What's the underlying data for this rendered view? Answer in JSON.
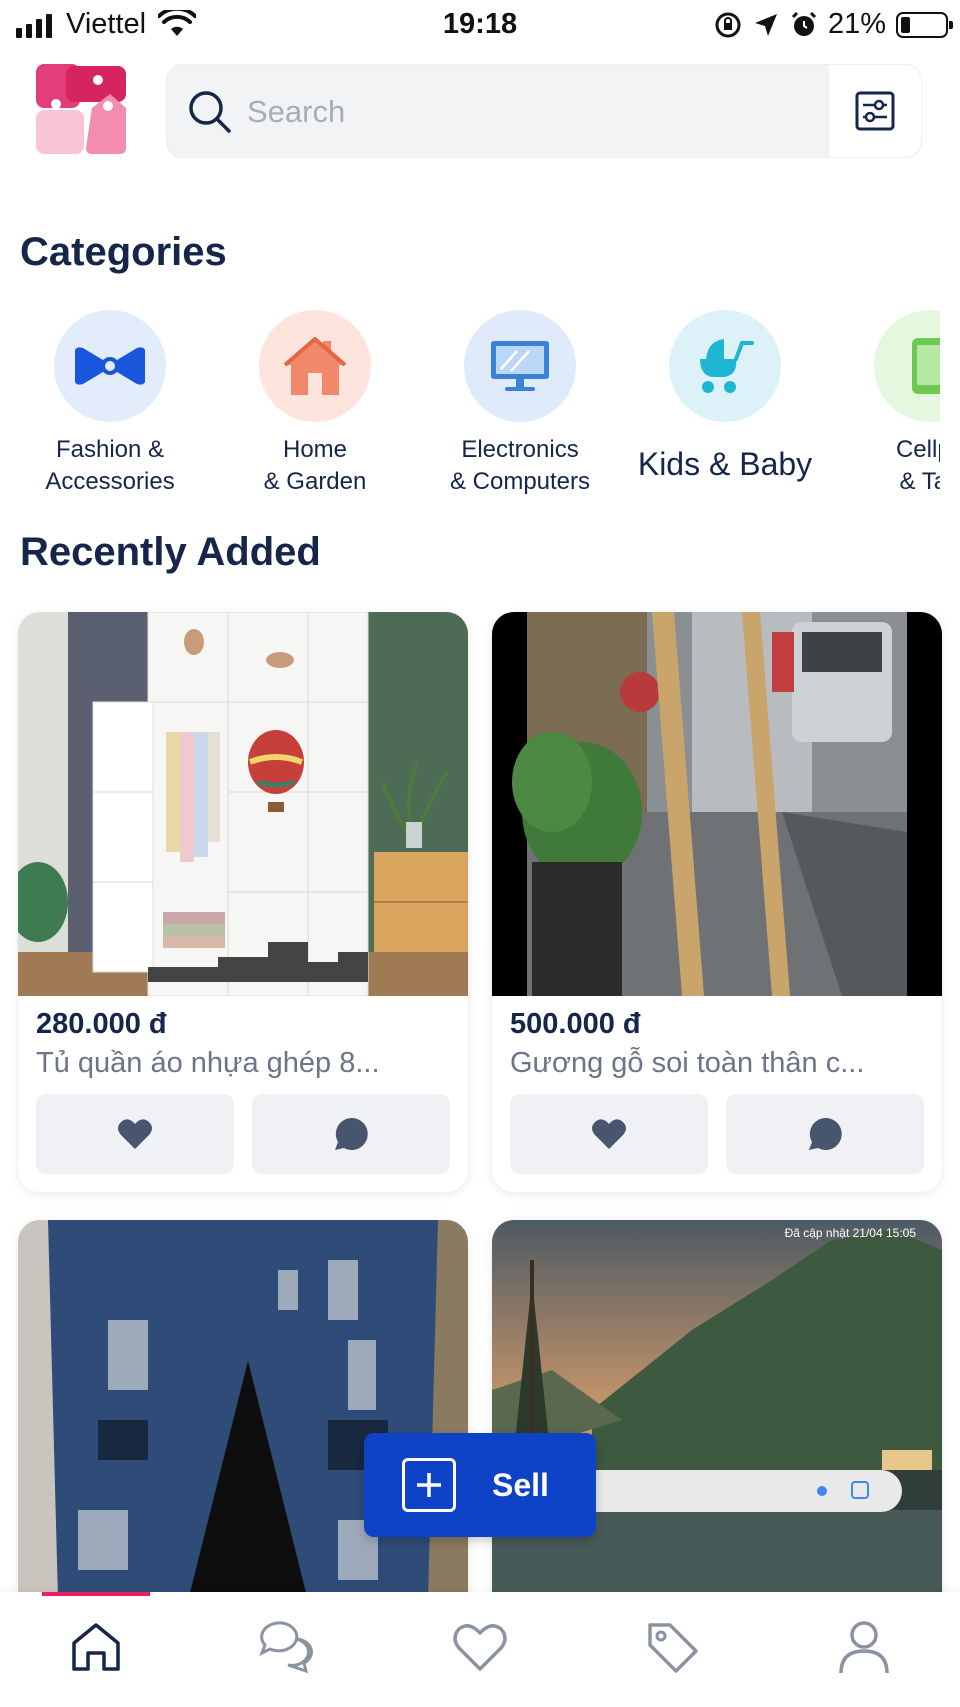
{
  "status_bar": {
    "carrier": "Viettel",
    "time": "19:18",
    "battery_percent": "21%",
    "battery_level": 0.21,
    "icons": [
      "signal-icon",
      "wifi-icon",
      "orientation-lock-icon",
      "location-icon",
      "alarm-icon",
      "battery-icon"
    ]
  },
  "header": {
    "logo": "app-logo",
    "search": {
      "placeholder": "Search",
      "value": ""
    },
    "filter_icon": "sliders-icon"
  },
  "categories": {
    "title": "Categories",
    "items": [
      {
        "label": "Fashion &\nAccessories",
        "icon": "bowtie-icon",
        "bg": "#e3ecfb",
        "color": "#1a56db"
      },
      {
        "label": "Home\n& Garden",
        "icon": "house-icon",
        "bg": "#fde4dc",
        "color": "#f2886b"
      },
      {
        "label": "Electronics\n& Computers",
        "icon": "monitor-icon",
        "bg": "#dfeafa",
        "color": "#3b82d6"
      },
      {
        "label": "Kids & Baby",
        "icon": "stroller-icon",
        "bg": "#dcf2f8",
        "color": "#1fb6d6"
      },
      {
        "label": "Cellph\n& Tab",
        "icon": "phone-icon",
        "bg": "#e6f7df",
        "color": "#6cc951"
      }
    ]
  },
  "recent": {
    "title": "Recently Added",
    "cards": [
      {
        "price": "280.000 đ",
        "title": "Tủ quần áo nhựa ghép 8...",
        "image": "wardrobe-photo"
      },
      {
        "price": "500.000 đ",
        "title": "Gương gỗ soi toàn thân c...",
        "image": "mirror-photo"
      },
      {
        "image": "jeans-photo"
      },
      {
        "image": "landscape-phone-screenshot",
        "overlay_text": "Đã cập nhật 21/04 15:05"
      }
    ]
  },
  "sell_button": {
    "label": "Sell"
  },
  "bottom_nav": {
    "active": "home",
    "items": [
      "home-icon",
      "chat-icon",
      "heart-icon",
      "tag-icon",
      "profile-icon"
    ]
  },
  "colors": {
    "primary": "#0f43c7",
    "text": "#15264a",
    "accent": "#e91e63"
  }
}
